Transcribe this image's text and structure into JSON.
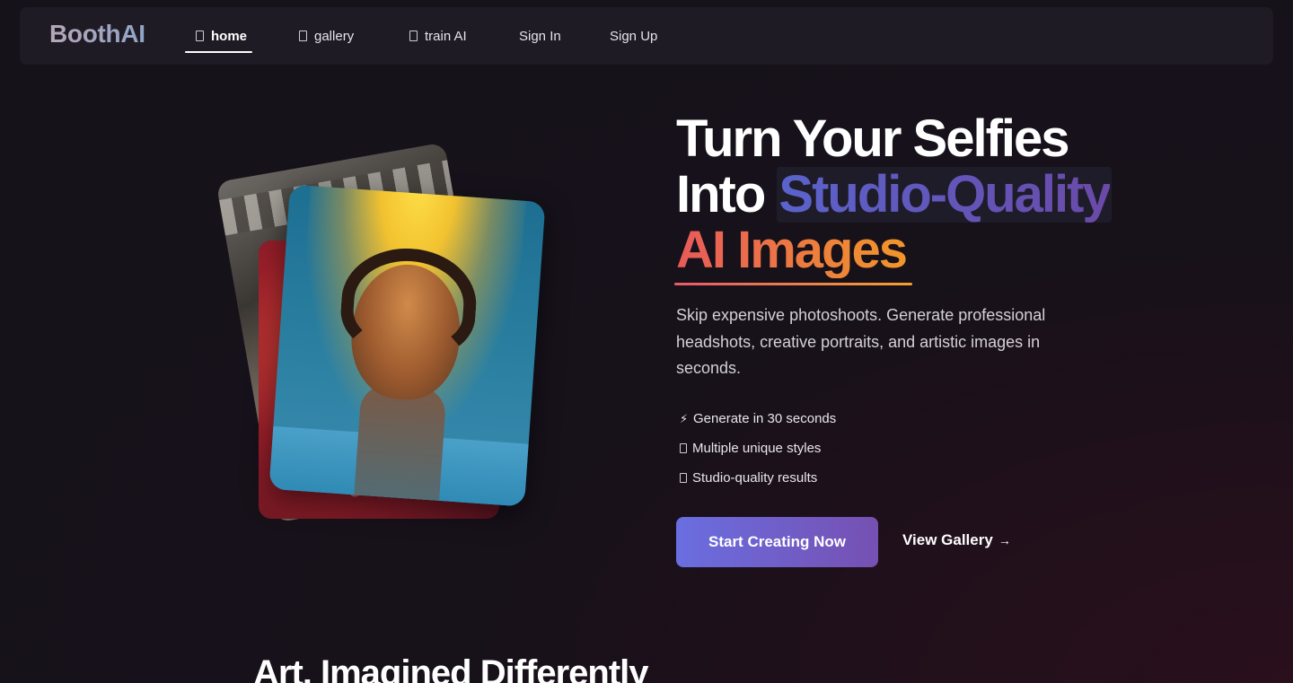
{
  "navbar": {
    "logo": "BoothAI",
    "items": [
      {
        "label": "home",
        "icon": "page-icon",
        "active": true
      },
      {
        "label": "gallery",
        "icon": "page-icon",
        "active": false
      },
      {
        "label": "train AI",
        "icon": "page-icon",
        "active": false
      },
      {
        "label": "Sign In",
        "active": false
      },
      {
        "label": "Sign Up",
        "active": false
      }
    ]
  },
  "hero": {
    "title_line1": "Turn Your Selfies",
    "title_line2_prefix": "Into ",
    "title_line2_highlight": "Studio-Quality",
    "title_line3": "AI Images",
    "description": "Skip expensive photoshoots. Generate professional headshots, creative portraits, and artistic images in seconds.",
    "features": [
      {
        "icon": "lightning-icon",
        "glyph": "⚡",
        "text": "Generate in 30 seconds"
      },
      {
        "icon": "palette-icon",
        "text": "Multiple unique styles"
      },
      {
        "icon": "camera-icon",
        "text": "Studio-quality results"
      }
    ],
    "primary_button": "Start Creating Now",
    "secondary_button": "View Gallery",
    "secondary_arrow": "→"
  },
  "section": {
    "title": "Art, Imagined Differently"
  },
  "colors": {
    "background": "#16121a",
    "navbar": "#1f1b24",
    "accent_purple": "#6a6ee0",
    "accent_orange": "#f0962a"
  }
}
